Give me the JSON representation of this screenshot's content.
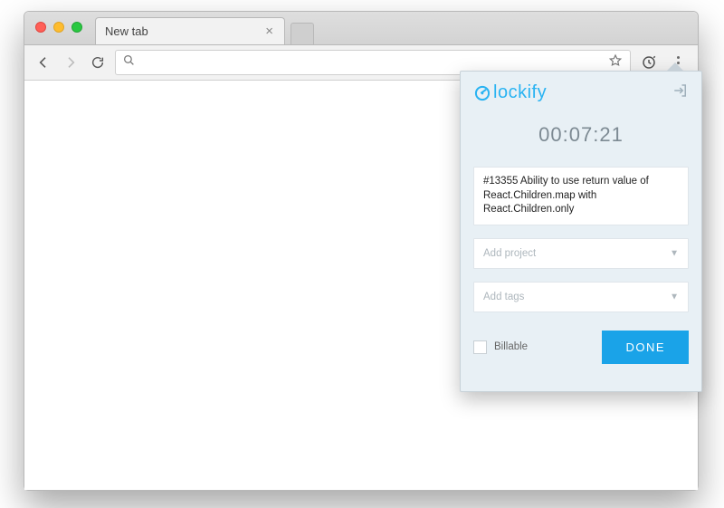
{
  "browser": {
    "tab_title": "New tab",
    "omnibox_value": "",
    "omnibox_placeholder": ""
  },
  "popup": {
    "logo_text": "lockify",
    "timer": "00:07:21",
    "description": "#13355 Ability to use return value of React.Children.map with React.Children.only",
    "project_placeholder": "Add project",
    "tags_placeholder": "Add tags",
    "billable_label": "Billable",
    "done_label": "DONE"
  }
}
